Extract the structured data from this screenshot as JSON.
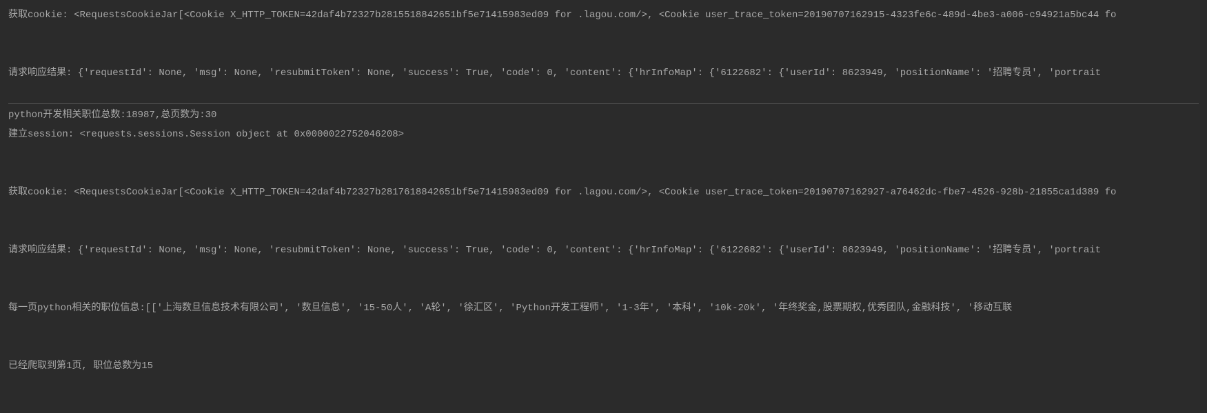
{
  "lines": {
    "l1": "获取cookie:  <RequestsCookieJar[<Cookie X_HTTP_TOKEN=42daf4b72327b2815518842651bf5e71415983ed09 for .lagou.com/>, <Cookie user_trace_token=20190707162915-4323fe6c-489d-4be3-a006-c94921a5bc44 fo",
    "l2": "请求响应结果:  {'requestId': None, 'msg': None, 'resubmitToken': None, 'success': True, 'code': 0, 'content': {'hrInfoMap': {'6122682': {'userId': 8623949, 'positionName': '招聘专员', 'portrait",
    "l3": "python开发相关职位总数:18987,总页数为:30",
    "l4": "建立session:  <requests.sessions.Session object at 0x0000022752046208>",
    "l5": "获取cookie:  <RequestsCookieJar[<Cookie X_HTTP_TOKEN=42daf4b72327b2817618842651bf5e71415983ed09 for .lagou.com/>, <Cookie user_trace_token=20190707162927-a76462dc-fbe7-4526-928b-21855ca1d389 fo",
    "l6": "请求响应结果:  {'requestId': None, 'msg': None, 'resubmitToken': None, 'success': True, 'code': 0, 'content': {'hrInfoMap': {'6122682': {'userId': 8623949, 'positionName': '招聘专员', 'portrait",
    "l7": "每一页python相关的职位信息:[['上海数旦信息技术有限公司', '数旦信息', '15-50人', 'A轮', '徐汇区', 'Python开发工程师', '1-3年', '本科', '10k-20k', '年终奖金,股票期权,优秀团队,金融科技', '移动互联",
    "l8": "已经爬取到第1页, 职位总数为15"
  }
}
